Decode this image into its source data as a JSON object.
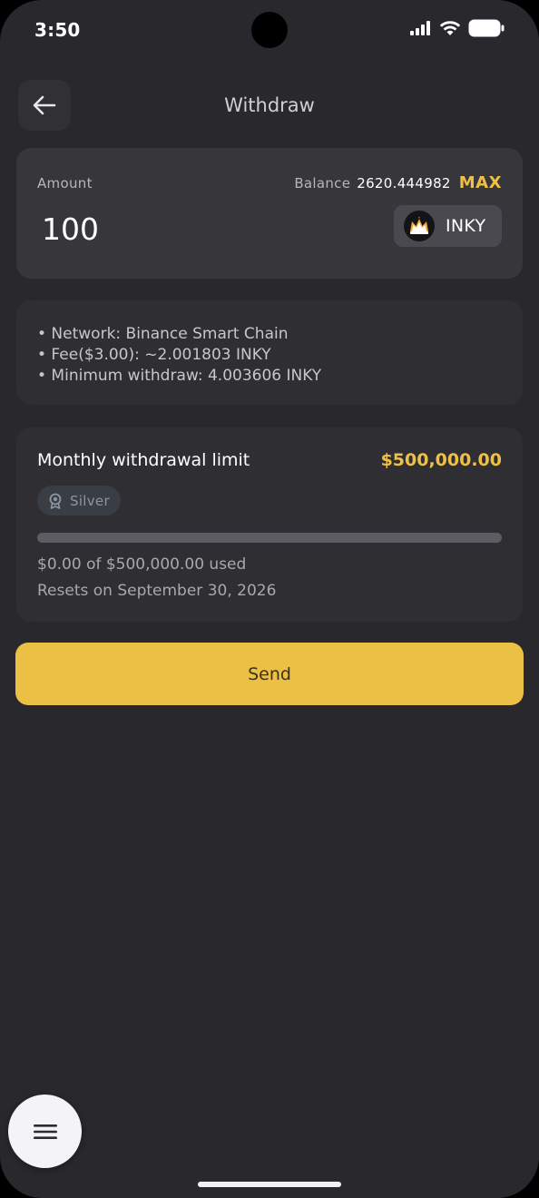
{
  "status_bar": {
    "time": "3:50"
  },
  "header": {
    "title": "Withdraw"
  },
  "amount_card": {
    "label": "Amount",
    "balance_label": "Balance",
    "balance_value": "2620.444982",
    "max_label": "MAX",
    "amount_value": "100",
    "token": "INKY"
  },
  "info": {
    "lines": [
      "• Network: Binance Smart Chain",
      "• Fee($3.00): ~2.001803 INKY",
      "• Minimum withdraw: 4.003606 INKY"
    ]
  },
  "limit": {
    "title": "Monthly withdrawal limit",
    "amount": "$500,000.00",
    "tier": "Silver",
    "used_fraction": 0,
    "usage_text": "$0.00 of $500,000.00 used",
    "reset_text": "Resets on September 30, 2026"
  },
  "actions": {
    "send_label": "Send"
  },
  "colors": {
    "accent": "#efc045",
    "background": "#29282d",
    "card": "#37363b",
    "button": "#ecbf45"
  },
  "icons": [
    "back-arrow-icon",
    "signal-icon",
    "wifi-icon",
    "battery-icon",
    "token-logo-icon",
    "medal-icon",
    "hamburger-menu-icon"
  ]
}
